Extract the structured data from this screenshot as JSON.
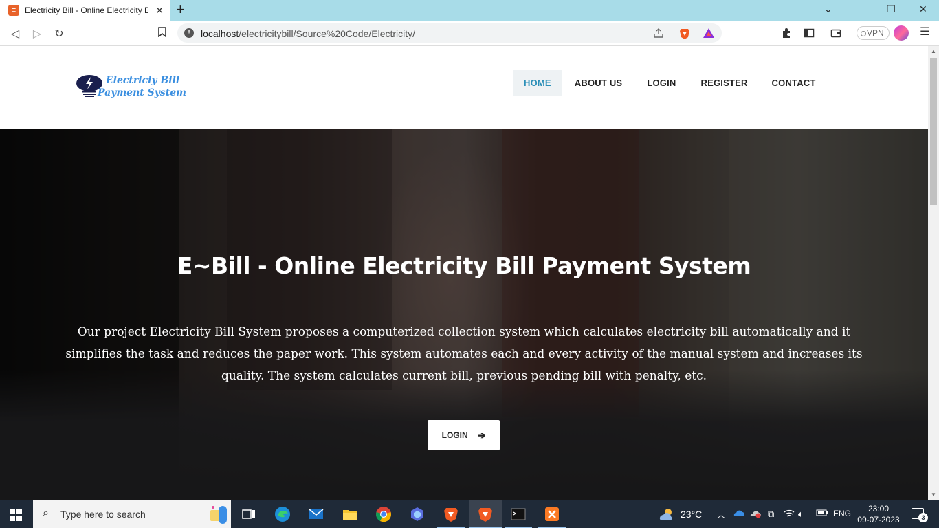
{
  "browser": {
    "tab_title": "Electricity Bill - Online Electricity Bill",
    "favicon_letter": "≡",
    "url_host": "localhost",
    "url_path": "/electricitybill/Source%20Code/Electricity/",
    "vpn_label": "VPN"
  },
  "site": {
    "logo_line1": "Electriciy Bill",
    "logo_line2": "Payment System",
    "nav": {
      "home": "HOME",
      "about": "ABOUT US",
      "login": "LOGIN",
      "register": "REGISTER",
      "contact": "CONTACT"
    },
    "active_nav": "HOME",
    "hero_title": "E~Bill - Online Electricity Bill Payment System",
    "hero_text": "Our project Electricity Bill System proposes a computerized collection system which calculates electricity bill automatically and it simplifies the task and reduces the paper work. This system automates each and every activity of the manual system and increases its quality. The system calculates current bill, previous pending bill with penalty, etc.",
    "cta_label": "LOGIN"
  },
  "taskbar": {
    "search_placeholder": "Type here to search",
    "weather": "23°C",
    "language": "ENG",
    "time": "23:00",
    "date": "09-07-2023",
    "notification_count": "3"
  },
  "colors": {
    "accent": "#2b8fb8",
    "logo_blue": "#3b8fe0",
    "tabbar": "#a8dce8",
    "taskbar": "#1f2a38"
  }
}
